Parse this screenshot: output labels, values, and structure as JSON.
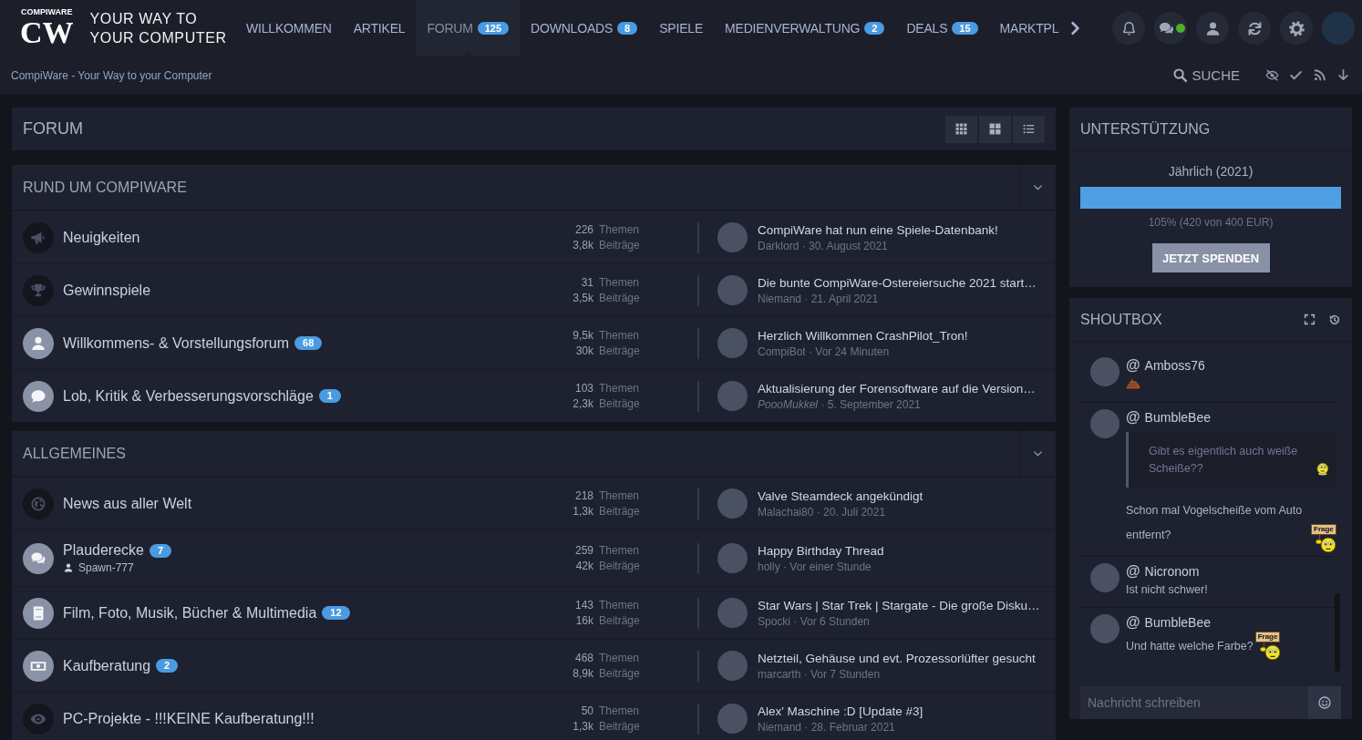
{
  "header": {
    "logo": {
      "letters": "CW",
      "caption": "COMPIWARE"
    },
    "tagline": [
      "YOUR WAY TO",
      "YOUR COMPUTER"
    ],
    "nav": [
      {
        "label": "WILLKOMMEN",
        "selected": false
      },
      {
        "label": "ARTIKEL",
        "selected": false
      },
      {
        "label": "FORUM",
        "badge": "125",
        "selected": true
      },
      {
        "label": "DOWNLOADS",
        "badge": "8",
        "selected": false
      },
      {
        "label": "SPIELE",
        "selected": false
      },
      {
        "label": "MEDIENVERWALTUNG",
        "badge": "2",
        "selected": false
      },
      {
        "label": "DEALS",
        "badge": "15",
        "selected": false
      },
      {
        "label": "MARKTPL",
        "selected": false
      }
    ],
    "user_menu": [
      {
        "kind": "notifications"
      },
      {
        "kind": "conversations",
        "online": true
      },
      {
        "kind": "user"
      },
      {
        "kind": "refresh"
      },
      {
        "kind": "settings"
      },
      {
        "kind": "avatar"
      }
    ]
  },
  "breadcrumb": {
    "link": "CompiWare - Your Way to your Computer",
    "search": "SUCHE",
    "actions": [
      {
        "kind": "hide"
      },
      {
        "kind": "mark-read"
      },
      {
        "kind": "rss"
      },
      {
        "kind": "scroll-down"
      }
    ]
  },
  "forum": {
    "title": "FORUM",
    "view_modes": [
      {
        "kind": "grid"
      },
      {
        "kind": "tiles"
      },
      {
        "kind": "list"
      }
    ]
  },
  "categories": [
    {
      "title": "RUND UM COMPIWARE",
      "expanded": true,
      "boards": [
        {
          "kind": "bullhorn",
          "name": "Neuigkeiten",
          "unread": false,
          "topics": "226",
          "topics_label": "Themen",
          "posts": "3,8k",
          "posts_label": "Beiträge",
          "last_post": {
            "title": "CompiWare hat nun eine Spiele-Datenbank!",
            "author": "Darklord",
            "author_italic": false,
            "separator": "·",
            "date": "30. August 2021"
          }
        },
        {
          "kind": "trophy",
          "name": "Gewinnspiele",
          "unread": false,
          "topics": "31",
          "topics_label": "Themen",
          "posts": "3,5k",
          "posts_label": "Beiträge",
          "last_post": {
            "title": "Die bunte CompiWare-Ostereiersuche 2021 start…",
            "author": "Niemand",
            "author_italic": false,
            "separator": "·",
            "date": "21. April 2021"
          }
        },
        {
          "kind": "user",
          "name": "Willkommens- & Vorstellungsforum",
          "badge": "68",
          "unread": true,
          "topics": "9,5k",
          "topics_label": "Themen",
          "posts": "30k",
          "posts_label": "Beiträge",
          "last_post": {
            "title": "Herzlich Willkommen CrashPilot_Tron!",
            "author": "CompiBot",
            "author_italic": false,
            "separator": "·",
            "date": "Vor 24 Minuten"
          }
        },
        {
          "kind": "comment",
          "name": "Lob, Kritik & Verbesserungsvorschläge",
          "badge": "1",
          "unread": true,
          "topics": "103",
          "topics_label": "Themen",
          "posts": "2,3k",
          "posts_label": "Beiträge",
          "last_post": {
            "title": "Aktualisierung der Forensoftware auf die Version…",
            "author": "PoooMukkel",
            "author_italic": true,
            "separator": "·",
            "date": "5. September 2021"
          }
        }
      ]
    },
    {
      "title": "ALLGEMEINES",
      "expanded": true,
      "boards": [
        {
          "kind": "globe",
          "name": "News aus aller Welt",
          "unread": false,
          "topics": "218",
          "topics_label": "Themen",
          "posts": "1,3k",
          "posts_label": "Beiträge",
          "last_post": {
            "title": "Valve Steamdeck angekündigt",
            "author": "Malachai80",
            "author_italic": false,
            "separator": "·",
            "date": "20. Juli 2021"
          }
        },
        {
          "kind": "comments",
          "name": "Plauderecke",
          "badge": "7",
          "unread": true,
          "moderator": "Spawn-777",
          "topics": "259",
          "topics_label": "Themen",
          "posts": "42k",
          "posts_label": "Beiträge",
          "last_post": {
            "title": "Happy Birthday Thread",
            "author": "holly",
            "author_italic": false,
            "separator": "·",
            "date": "Vor einer Stunde"
          }
        },
        {
          "kind": "book",
          "name": "Film, Foto, Musik, Bücher & Multimedia",
          "badge": "12",
          "unread": true,
          "topics": "143",
          "topics_label": "Themen",
          "posts": "16k",
          "posts_label": "Beiträge",
          "last_post": {
            "title": "Star Wars | Star Trek | Stargate - Die große Disku…",
            "author": "Spocki",
            "author_italic": false,
            "separator": "·",
            "date": "Vor 6 Stunden"
          }
        },
        {
          "kind": "banknote",
          "name": "Kaufberatung",
          "badge": "2",
          "unread": true,
          "topics": "468",
          "topics_label": "Themen",
          "posts": "8,9k",
          "posts_label": "Beiträge",
          "last_post": {
            "title": "Netzteil, Gehäuse und evt. Prozessorlüfter gesucht",
            "author": "marcarth",
            "author_italic": false,
            "separator": "·",
            "date": "Vor 7 Stunden"
          }
        },
        {
          "kind": "eye",
          "name": "PC-Projekte - !!!KEINE Kaufberatung!!!",
          "unread": false,
          "topics": "50",
          "topics_label": "Themen",
          "posts": "1,3k",
          "posts_label": "Beiträge",
          "last_post": {
            "title": "Alex' Maschine :D [Update #3]",
            "author": "Niemand",
            "author_italic": false,
            "separator": "·",
            "date": "28. Februar 2021"
          }
        }
      ]
    }
  ],
  "sidebar": {
    "support": {
      "title": "UNTERSTÜTZUNG",
      "period": "Jährlich (2021)",
      "level": 1,
      "summary": "105% (420 von 400 EUR)",
      "button": "JETZT SPENDEN"
    },
    "shoutbox": {
      "title": "SHOUTBOX",
      "messages": [
        {
          "mention": "@",
          "author": "Amboss76",
          "content": [
            {
              "kind": "poop"
            }
          ]
        },
        {
          "mention": "@",
          "author": "BumbleBee",
          "content": [
            {
              "kind": "quote",
              "text": "Gibt es eigentlich auch weiße Scheiße??",
              "emoticons": [
                {
                  "kind": "confused"
                }
              ]
            },
            {
              "kind": "text",
              "text": "Schon mal Vogelscheiße vom Auto entfernt?",
              "sign": "Frage"
            }
          ]
        },
        {
          "mention": "@",
          "author": "Nicronom",
          "content": [
            {
              "kind": "text",
              "text": "Ist nicht schwer!"
            }
          ]
        },
        {
          "mention": "@",
          "author": "BumbleBee",
          "content": [
            {
              "kind": "text",
              "text": "Und hatte welche Farbe?",
              "sign": "Frage"
            }
          ]
        }
      ],
      "input": {
        "placeholder": "Nachricht schreiben"
      }
    }
  }
}
